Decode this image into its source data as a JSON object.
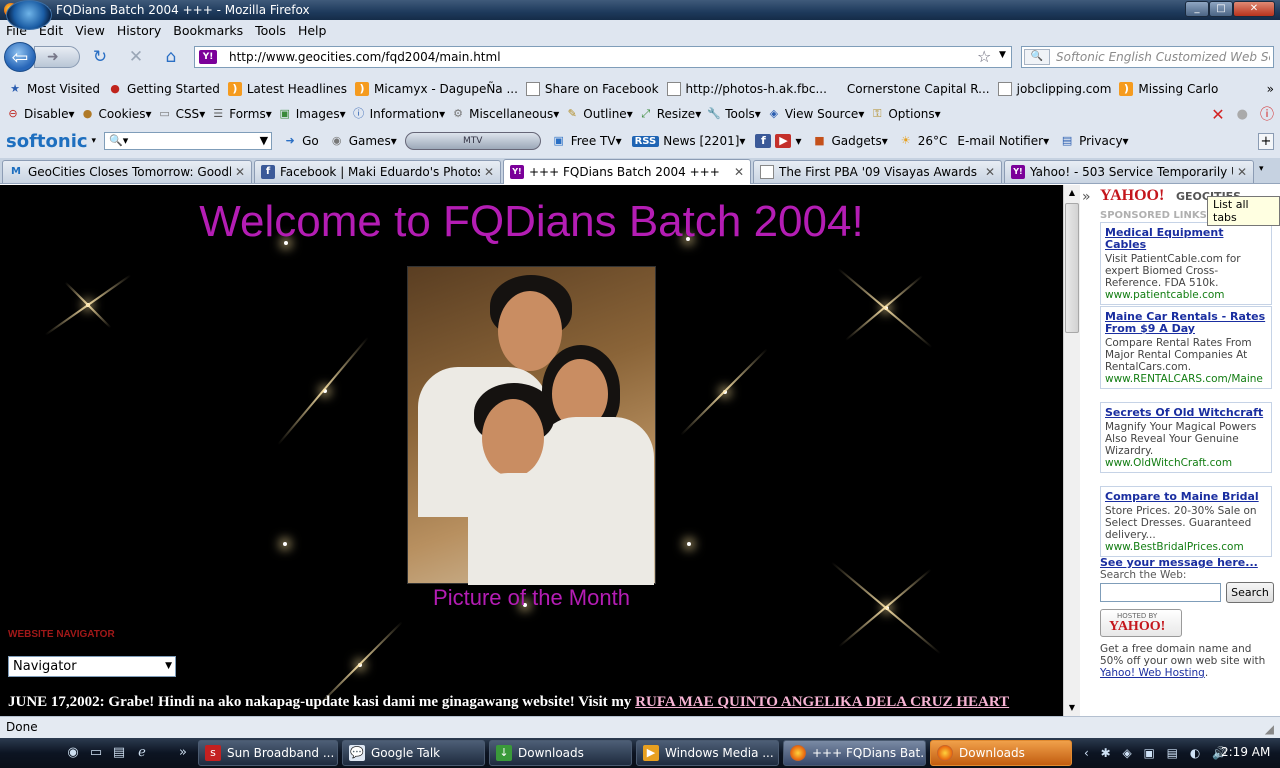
{
  "window": {
    "title": "+++ FQDians Batch 2004 +++ - Mozilla Firefox",
    "controls": [
      "_",
      "□",
      "✕"
    ]
  },
  "menu": [
    "File",
    "Edit",
    "View",
    "History",
    "Bookmarks",
    "Tools",
    "Help"
  ],
  "navigation": {
    "url": "http://www.geocities.com/fqd2004/main.html",
    "site_icon": "Y!",
    "search_placeholder": "Softonic English Customized Web Search"
  },
  "bookmarks": [
    {
      "label": "Most Visited",
      "icon": "star-icon"
    },
    {
      "label": "Getting Started",
      "icon": "firefox-icon"
    },
    {
      "label": "Latest Headlines",
      "icon": "rss-icon"
    },
    {
      "label": "Micamyx - DagupeÑa ...",
      "icon": "rss-icon"
    },
    {
      "label": "Share on Facebook",
      "icon": "page-icon"
    },
    {
      "label": "http://photos-h.ak.fbc...",
      "icon": "page-icon"
    },
    {
      "label": "Cornerstone Capital R...",
      "icon": "blank-icon"
    },
    {
      "label": "jobclipping.com",
      "icon": "page-icon"
    },
    {
      "label": "Missing Carlo",
      "icon": "rss-icon"
    }
  ],
  "webdev_toolbar": [
    "Disable",
    "Cookies",
    "CSS",
    "Forms",
    "Images",
    "Information",
    "Miscellaneous",
    "Outline",
    "Resize",
    "Tools",
    "View Source",
    "Options"
  ],
  "softonic_toolbar": {
    "logo": "softonic",
    "go": "Go",
    "games": "Games",
    "player": "MTV",
    "free_tv": "Free TV",
    "rss": "RSS",
    "news": "News [2201]",
    "gadgets": "Gadgets",
    "weather": "26°C",
    "email": "E-mail Notifier",
    "privacy": "Privacy"
  },
  "tabs": [
    {
      "label": "GeoCities Closes Tomorrow: Goodb...",
      "icon": "M",
      "active": false
    },
    {
      "label": "Facebook | Maki Eduardo's Photos -...",
      "icon": "f",
      "active": false
    },
    {
      "label": "+++ FQDians Batch 2004 +++",
      "icon": "Y!",
      "active": true
    },
    {
      "label": "The First PBA '09 Visayas Awards Ni...",
      "icon": "",
      "active": false
    },
    {
      "label": "Yahoo! - 503 Service Temporarily U...",
      "icon": "Y!",
      "active": false
    }
  ],
  "page": {
    "heading": "Welcome to FQDians Batch 2004!",
    "photo_caption": "Picture of the Month",
    "nav_label": "WEBSITE NAVIGATOR",
    "nav_select": "Navigator",
    "news_text": "JUNE 17,2002: Grabe! Hindi na ako nakapag-update kasi dami me ginagawang website! Visit my ",
    "news_link": "RUFA MAE QUINTO ANGELIKA DELA CRUZ HEART",
    "colors": {
      "heading": "#b41db4",
      "background": "#000000",
      "link": "#f7b4d4"
    }
  },
  "sidebar": {
    "yahoo": "YAHOO!",
    "geocities": "GEOCITIES",
    "sponsored": "SPONSORED LINKS",
    "tooltip": "List all tabs",
    "ads": [
      {
        "title": "Medical Equipment Cables",
        "body": "Visit PatientCable.com for expert Biomed Cross-Reference. FDA 510k.",
        "url": "www.patientcable.com"
      },
      {
        "title": "Maine Car Rentals - Rates From $9 A Day",
        "body": "Compare Rental Rates From Major Rental Companies At RentalCars.com.",
        "url": "www.RENTALCARS.com/Maine"
      },
      {
        "title": "Secrets Of Old Witchcraft",
        "body": "Magnify Your Magical Powers Also Reveal Your Genuine Wizardry.",
        "url": "www.OldWitchCraft.com"
      },
      {
        "title": "Compare to Maine Bridal",
        "body": "Store Prices. 20-30% Sale on Select Dresses. Guaranteed delivery...",
        "url": "www.BestBridalPrices.com"
      }
    ],
    "see_message": "See your message here...",
    "search_label": "Search the Web:",
    "search_button": "Search",
    "hosted_by": "HOSTED BY",
    "hosted_yahoo": "YAHOO!",
    "free_text": "Get a free domain name and 50% off your own web site with ",
    "free_link": "Yahoo! Web Hosting",
    "free_end": "."
  },
  "status": "Done",
  "taskbar": {
    "buttons": [
      {
        "label": "Sun Broadband ...",
        "icon": "sun"
      },
      {
        "label": "Google Talk",
        "icon": "talk"
      },
      {
        "label": "Downloads",
        "icon": "dl"
      },
      {
        "label": "Windows Media ...",
        "icon": "wmp"
      },
      {
        "label": "+++ FQDians Bat...",
        "icon": "ff"
      },
      {
        "label": "Downloads",
        "icon": "ff"
      }
    ],
    "clock": "2:19 AM"
  }
}
